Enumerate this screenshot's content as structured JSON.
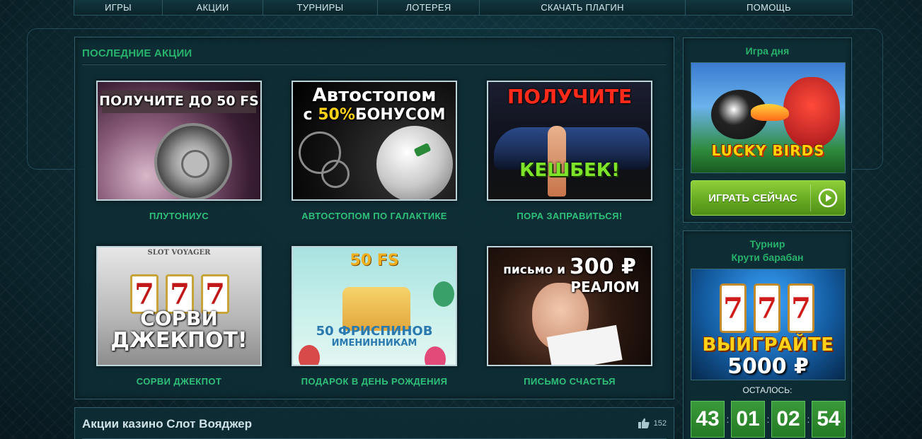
{
  "nav": {
    "items": [
      {
        "label": "ИГРЫ"
      },
      {
        "label": "АКЦИИ"
      },
      {
        "label": "ТУРНИРЫ"
      },
      {
        "label": "ЛОТЕРЕЯ"
      },
      {
        "label": "СКАЧАТЬ ПЛАГИН"
      },
      {
        "label": "ПОМОЩЬ"
      }
    ]
  },
  "promos": {
    "title": "ПОСЛЕДНИЕ АКЦИИ",
    "cards": [
      {
        "label": "ПЛУТОНИУС",
        "banner": "ПОЛУЧИТЕ ДО 50 FS"
      },
      {
        "label": "АВТОСТОПОМ ПО ГАЛАКТИКЕ",
        "banner_line1": "Автостопом",
        "banner_line2_pre": "с ",
        "banner_line2_hi": "50%",
        "banner_line2_post": "БОНУСОМ"
      },
      {
        "label": "ПОРА ЗАПРАВИТЬСЯ!",
        "banner_top": "ПОЛУЧИТЕ",
        "banner_bottom": "КЕШБЕК!"
      },
      {
        "label": "СОРВИ ДЖЕКПОТ",
        "brand": "SLOT VOYAGER",
        "reel": "7",
        "banner_line1": "СОРВИ",
        "banner_line2": "ДЖЕКПОТ!"
      },
      {
        "label": "ПОДАРОК В ДЕНЬ РОЖДЕНИЯ",
        "banner_top": "50 FS",
        "banner_line1": "50 ФРИСПИНОВ",
        "banner_line2": "ИМЕНИННИКАМ"
      },
      {
        "label": "ПИСЬМО СЧАСТЬЯ",
        "banner_pre": "письмо и ",
        "banner_amount": "300 ₽",
        "banner_line2": "РЕАЛОМ"
      }
    ]
  },
  "footer_strip": {
    "title": "Акции казино Слот Вояджер",
    "likes": "152"
  },
  "game_of_day": {
    "title": "Игра дня",
    "game_logo": "LUCKY BIRDS",
    "play_label": "ИГРАТЬ СЕЙЧАС"
  },
  "tournament": {
    "title_line1": "Турнир",
    "title_line2": "Крути барабан",
    "banner_win": "ВЫИГРАЙТЕ",
    "banner_amount": "5000 ₽",
    "reel": "7",
    "remaining_label": "ОСТАЛОСЬ:",
    "countdown": [
      "43",
      "01",
      "02",
      "54"
    ]
  }
}
